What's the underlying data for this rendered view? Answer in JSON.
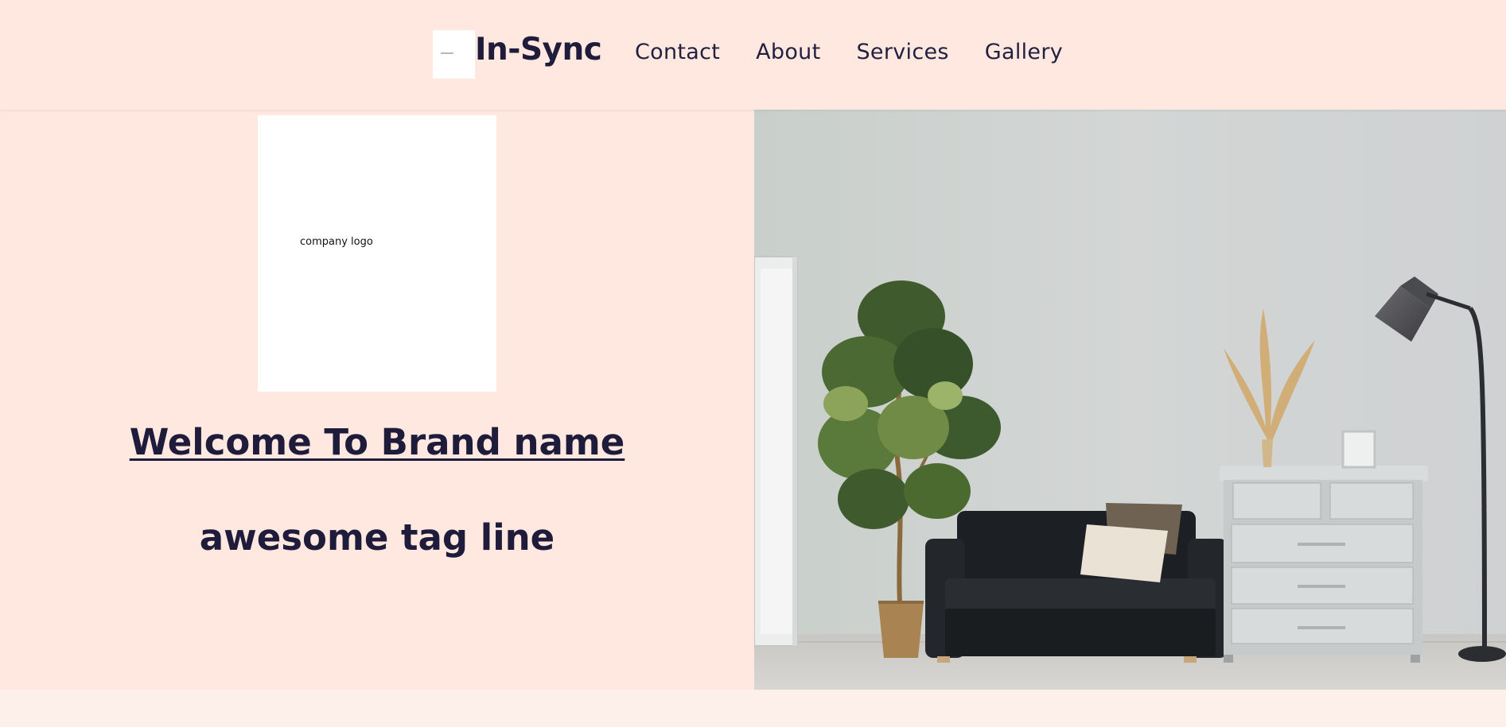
{
  "header": {
    "brand_name": "In-Sync",
    "nav": [
      "Contact",
      "About",
      "Services",
      "Gallery"
    ]
  },
  "hero": {
    "logo_placeholder": "company logo",
    "welcome_text": "Welcome To Brand name",
    "tagline": "awesome tag line"
  },
  "colors": {
    "background": "#fee8e0",
    "text": "#1f1b3b"
  }
}
